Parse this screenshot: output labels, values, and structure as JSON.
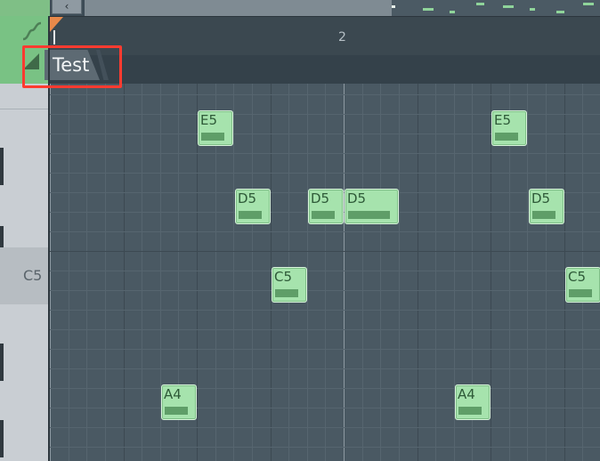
{
  "ruler": {
    "bar_label": "2"
  },
  "pattern_tab": {
    "label": "Test"
  },
  "keyboard": {
    "c5_label": "C5"
  },
  "notes": [
    {
      "label": "E5",
      "pitch": "E5",
      "start": 2,
      "length": 1
    },
    {
      "label": "D5",
      "pitch": "D5",
      "start": 3,
      "length": 1
    },
    {
      "label": "C5",
      "pitch": "C5",
      "start": 4,
      "length": 1
    },
    {
      "label": "D5",
      "pitch": "D5",
      "start": 5,
      "length": 1
    },
    {
      "label": "D5",
      "pitch": "D5",
      "start": 6,
      "length": 1.5
    },
    {
      "label": "A4",
      "pitch": "A4",
      "start": 1,
      "length": 1
    },
    {
      "label": "E5",
      "pitch": "E5",
      "start": 10,
      "length": 1
    },
    {
      "label": "D5",
      "pitch": "D5",
      "start": 11,
      "length": 1
    },
    {
      "label": "C5",
      "pitch": "C5",
      "start": 12,
      "length": 1
    },
    {
      "label": "A4",
      "pitch": "A4",
      "start": 9,
      "length": 1
    }
  ],
  "colors": {
    "note_fill": "#a6e3ad",
    "highlight": "#ff3b30",
    "playhead": "#e8894a",
    "grid": "#4a5963"
  },
  "icons": {
    "nav": "left-arrow-icon",
    "curve": "curve-icon",
    "ramp": "ramp-icon"
  }
}
